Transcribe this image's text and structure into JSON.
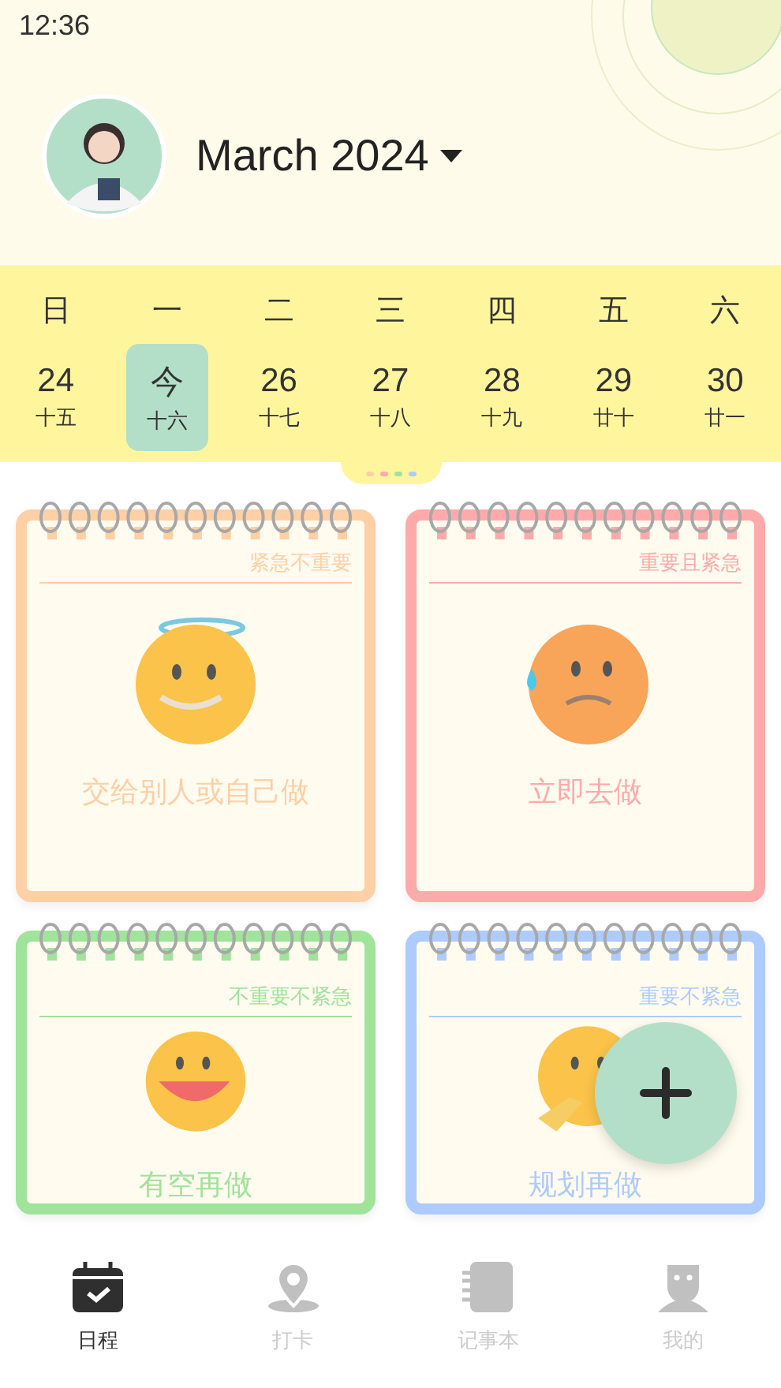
{
  "status_bar": {
    "time": "12:36"
  },
  "header": {
    "month": "March 2024"
  },
  "calendar": {
    "weekdays": [
      "日",
      "一",
      "二",
      "三",
      "四",
      "五",
      "六"
    ],
    "days": [
      {
        "day": "24",
        "lunar": "十五",
        "selected": false
      },
      {
        "day": "今",
        "lunar": "十六",
        "selected": true
      },
      {
        "day": "26",
        "lunar": "十七",
        "selected": false
      },
      {
        "day": "27",
        "lunar": "十八",
        "selected": false
      },
      {
        "day": "28",
        "lunar": "十九",
        "selected": false
      },
      {
        "day": "29",
        "lunar": "廿十",
        "selected": false
      },
      {
        "day": "30",
        "lunar": "廿一",
        "selected": false
      }
    ]
  },
  "quadrants": [
    {
      "tag": "紧急不重要",
      "title": "交给别人或自己做",
      "color": "#ffcfa5",
      "kind": "halo"
    },
    {
      "tag": "重要且紧急",
      "title": "立即去做",
      "color": "#ffaaaa",
      "kind": "sweat"
    },
    {
      "tag": "不重要不紧急",
      "title": "有空再做",
      "color": "#a0e39a",
      "kind": "grin"
    },
    {
      "tag": "重要不紧急",
      "title": "规划再做",
      "color": "#aecbff",
      "kind": "thinking"
    }
  ],
  "nav": [
    {
      "label": "日程",
      "kind": "calendar",
      "selected": true
    },
    {
      "label": "打卡",
      "kind": "pin",
      "selected": false
    },
    {
      "label": "记事本",
      "kind": "notebook",
      "selected": false
    },
    {
      "label": "我的",
      "kind": "person",
      "selected": false
    }
  ]
}
